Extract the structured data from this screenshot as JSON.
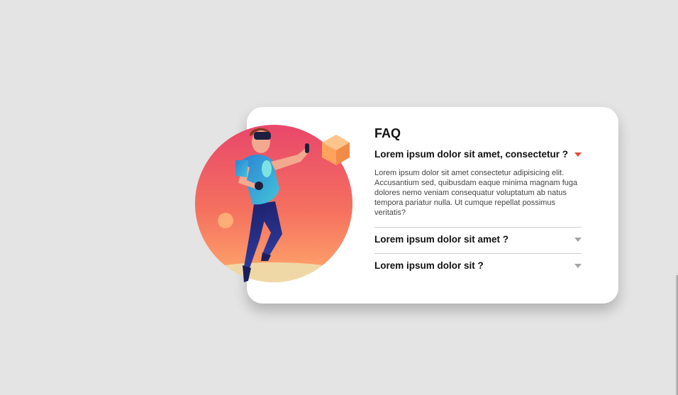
{
  "faq": {
    "title": "FAQ",
    "items": [
      {
        "question": "Lorem ipsum dolor sit amet, consectetur ?",
        "answer": "Lorem ipsum dolor sit amet consectetur adipisicing elit. Accusantium sed, quibusdam eaque minima magnam fuga dolores nemo veniam consequatur voluptatum ab natus tempora pariatur nulla. Ut cumque repellat possimus veritatis?",
        "expanded": true
      },
      {
        "question": "Lorem ipsum dolor sit amet ?",
        "expanded": false
      },
      {
        "question": "Lorem ipsum dolor sit ?",
        "expanded": false
      }
    ]
  },
  "icons": {
    "expand": "chevron-down-icon"
  },
  "colors": {
    "background": "#e4e4e4",
    "card": "#ffffff",
    "accent_arrow": "#e44d33",
    "muted_arrow": "#a5a5a5",
    "gradient_top": "#e8476a",
    "gradient_bottom": "#ffa56a"
  }
}
